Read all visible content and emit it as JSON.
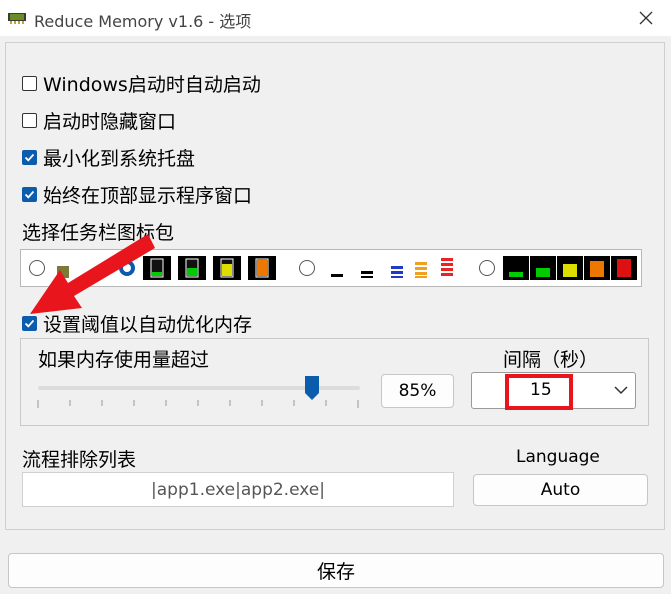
{
  "window": {
    "title": "Reduce Memory v1.6 - 选项"
  },
  "options": {
    "autostart_label": "Windows启动时自动启动",
    "autostart_checked": false,
    "hide_on_start_label": "启动时隐藏窗口",
    "hide_on_start_checked": false,
    "minimize_to_tray_label": "最小化到系统托盘",
    "minimize_to_tray_checked": true,
    "always_on_top_label": "始终在顶部显示程序窗口",
    "always_on_top_checked": true
  },
  "icon_pack": {
    "label": "选择任务栏图标包",
    "selected_index": 1,
    "packs": [
      "pack-1",
      "pack-2",
      "pack-3",
      "pack-4"
    ]
  },
  "threshold": {
    "checkbox_label": "设置阈值以自动优化内存",
    "checked": true,
    "memory_label": "如果内存使用量超过",
    "percent_value": "85%",
    "slider_fraction": 0.85,
    "interval_label": "间隔（秒）",
    "interval_value": "15"
  },
  "exclusions": {
    "label": "流程排除列表",
    "value": "|app1.exe|app2.exe|"
  },
  "language": {
    "label": "Language",
    "value": "Auto"
  },
  "footer": {
    "save_label": "保存"
  },
  "colors": {
    "accent": "#0b5cad",
    "annotation_red": "#e8161c"
  }
}
